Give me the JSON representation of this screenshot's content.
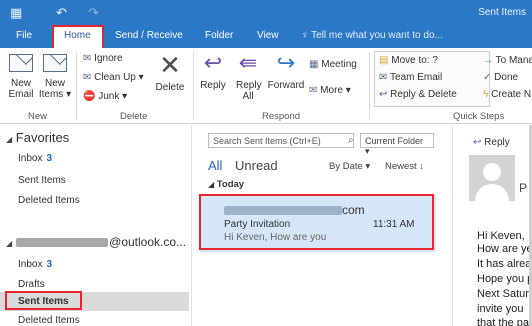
{
  "window": {
    "title": "Sent Items"
  },
  "quick_access": {
    "undo_icon": "undo-icon",
    "redo_icon": "redo-icon"
  },
  "tabs": [
    {
      "label": "File"
    },
    {
      "label": "Home"
    },
    {
      "label": "Send / Receive"
    },
    {
      "label": "Folder"
    },
    {
      "label": "View"
    }
  ],
  "tell_me": {
    "placeholder": "Tell me what you want to do..."
  },
  "ribbon": {
    "new": {
      "new_email": "New Email",
      "new_items": "New Items",
      "group": "New"
    },
    "delete": {
      "ignore": "Ignore",
      "clean_up": "Clean Up",
      "junk": "Junk",
      "delete": "Delete",
      "group": "Delete"
    },
    "respond": {
      "reply": "Reply",
      "reply_all": "Reply All",
      "forward": "Forward",
      "meeting": "Meeting",
      "more": "More",
      "group": "Respond"
    },
    "quick_steps": {
      "move_to": "Move to: ?",
      "team_email": "Team Email",
      "reply_delete": "Reply & Delete",
      "to_manager": "To Mana",
      "done": "Done",
      "create_new": "Create N",
      "group": "Quick Steps"
    }
  },
  "folders": {
    "favorites_header": "Favorites",
    "favorites": [
      {
        "label": "Inbox",
        "count": "3"
      },
      {
        "label": "Sent Items"
      },
      {
        "label": "Deleted Items"
      }
    ],
    "account_suffix": "@outlook.co...",
    "account_items": [
      {
        "label": "Inbox",
        "count": "3"
      },
      {
        "label": "Drafts"
      },
      {
        "label": "Sent Items"
      },
      {
        "label": "Deleted Items"
      }
    ]
  },
  "message_list": {
    "search_placeholder": "Search Sent Items (Ctrl+E)",
    "scope": "Current Folder",
    "filter_all": "All",
    "filter_unread": "Unread",
    "sort_by": "By Date",
    "order": "Newest",
    "group_today": "Today",
    "messages": [
      {
        "from_suffix": "com",
        "subject": "Party Invitation",
        "time": "11:31 AM",
        "preview": "Hi Keven,  How are you"
      }
    ]
  },
  "reading_pane": {
    "reply": "Reply",
    "sender_initial": "P",
    "lines": [
      "Hi Keven,",
      "How are ye",
      "It has alrea",
      "Hope you p",
      "Next Satur",
      "invite you",
      "that the pa"
    ]
  },
  "colors": {
    "accent": "#2b78c7",
    "highlight": "#e5262d",
    "selected_message": "#d5e6f7"
  }
}
